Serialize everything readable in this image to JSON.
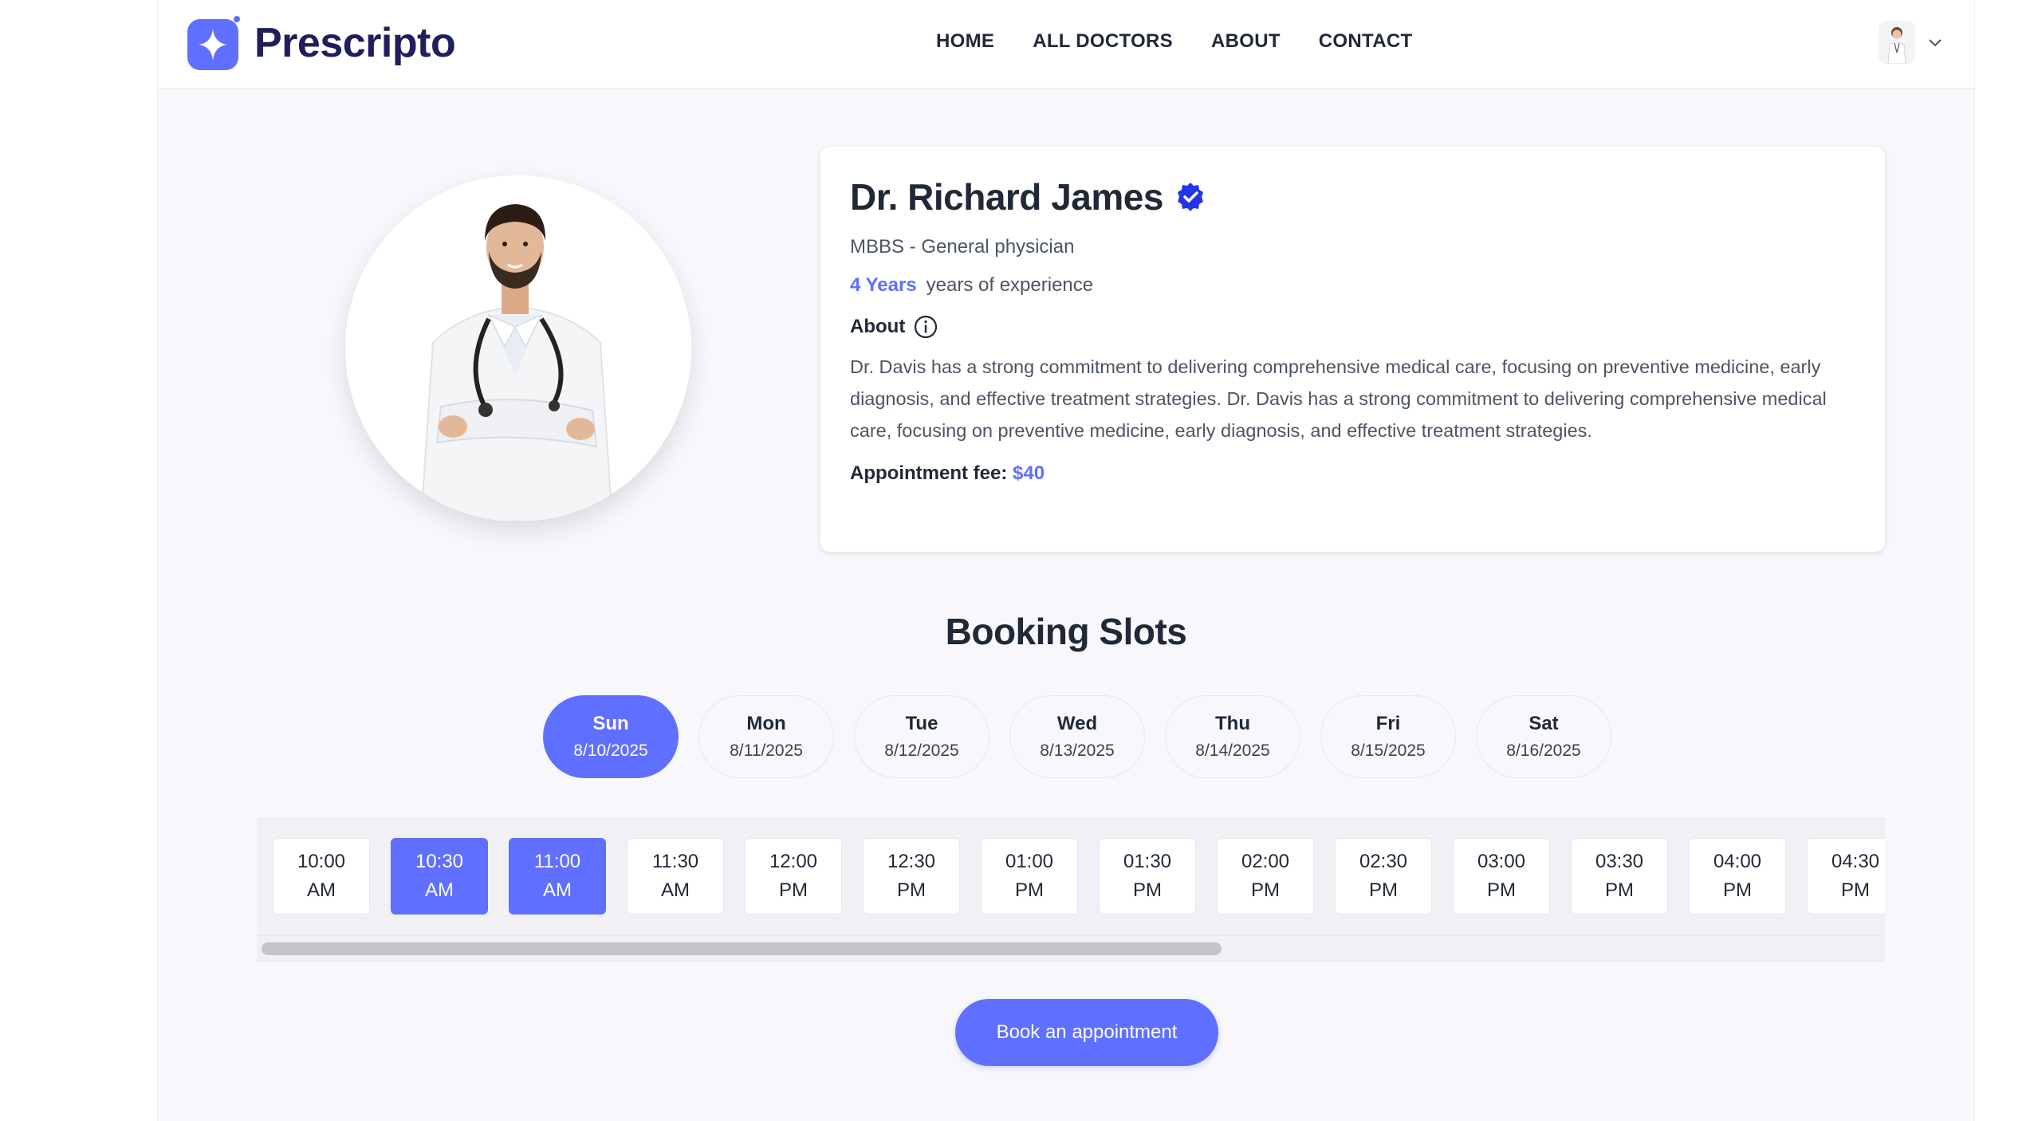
{
  "brand": {
    "name": "Prescripto",
    "accent": "#5f6fff",
    "dark": "#1e1f5c"
  },
  "nav": {
    "items": [
      "HOME",
      "ALL DOCTORS",
      "ABOUT",
      "CONTACT"
    ]
  },
  "profile": {
    "avatar_icon": "user-avatar-icon",
    "menu_icon": "chevron-down-icon"
  },
  "doctor": {
    "name": "Dr. Richard James",
    "degree": "MBBS - General physician",
    "experience_years": "4 Years",
    "experience_label": "years of experience",
    "about_label": "About",
    "about_text": "Dr. Davis has a strong commitment to delivering comprehensive medical care, focusing on preventive medicine, early diagnosis, and effective treatment strategies. Dr. Davis has a strong commitment to delivering comprehensive medical care, focusing on preventive medicine, early diagnosis, and effective treatment strategies.",
    "fee_label": "Appointment fee:",
    "fee_value": "$40"
  },
  "booking": {
    "title": "Booking Slots",
    "days": [
      {
        "name": "Sun",
        "date": "8/10/2025",
        "selected": true
      },
      {
        "name": "Mon",
        "date": "8/11/2025",
        "selected": false
      },
      {
        "name": "Tue",
        "date": "8/12/2025",
        "selected": false
      },
      {
        "name": "Wed",
        "date": "8/13/2025",
        "selected": false
      },
      {
        "name": "Thu",
        "date": "8/14/2025",
        "selected": false
      },
      {
        "name": "Fri",
        "date": "8/15/2025",
        "selected": false
      },
      {
        "name": "Sat",
        "date": "8/16/2025",
        "selected": false
      }
    ],
    "slots": [
      {
        "time": "10:00",
        "period": "AM",
        "selected": false
      },
      {
        "time": "10:30",
        "period": "AM",
        "selected": true
      },
      {
        "time": "11:00",
        "period": "AM",
        "selected": true
      },
      {
        "time": "11:30",
        "period": "AM",
        "selected": false
      },
      {
        "time": "12:00",
        "period": "PM",
        "selected": false
      },
      {
        "time": "12:30",
        "period": "PM",
        "selected": false
      },
      {
        "time": "01:00",
        "period": "PM",
        "selected": false
      },
      {
        "time": "01:30",
        "period": "PM",
        "selected": false
      },
      {
        "time": "02:00",
        "period": "PM",
        "selected": false
      },
      {
        "time": "02:30",
        "period": "PM",
        "selected": false
      },
      {
        "time": "03:00",
        "period": "PM",
        "selected": false
      },
      {
        "time": "03:30",
        "period": "PM",
        "selected": false
      },
      {
        "time": "04:00",
        "period": "PM",
        "selected": false
      },
      {
        "time": "04:30",
        "period": "PM",
        "selected": false
      }
    ],
    "button_label": "Book an appointment"
  }
}
